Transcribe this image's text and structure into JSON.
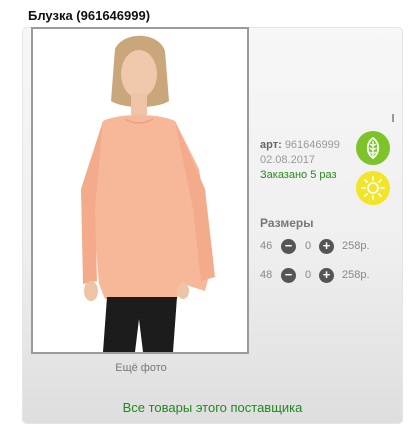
{
  "product": {
    "title": "Блузка (961646999)",
    "art_label": "арт:",
    "art_value": "961646999",
    "date": "02.08.2017",
    "ordered": "Заказано 5 раз",
    "more_photos": "Ещё фото"
  },
  "badges": [
    {
      "icon": "leaf-icon",
      "color": "#7dc429"
    },
    {
      "icon": "sun-icon",
      "color": "#f1e526"
    }
  ],
  "sizes": {
    "header": "Размеры",
    "rows": [
      {
        "size": "46",
        "minus": "−",
        "qty": "0",
        "plus": "+",
        "price": "258р."
      },
      {
        "size": "48",
        "minus": "−",
        "qty": "0",
        "plus": "+",
        "price": "258р."
      }
    ]
  },
  "supplier_link": "Все товары этого поставщика",
  "colors": {
    "accent_green": "#2a8a1f",
    "badge_green": "#7dc429",
    "badge_yellow": "#f1e526"
  }
}
